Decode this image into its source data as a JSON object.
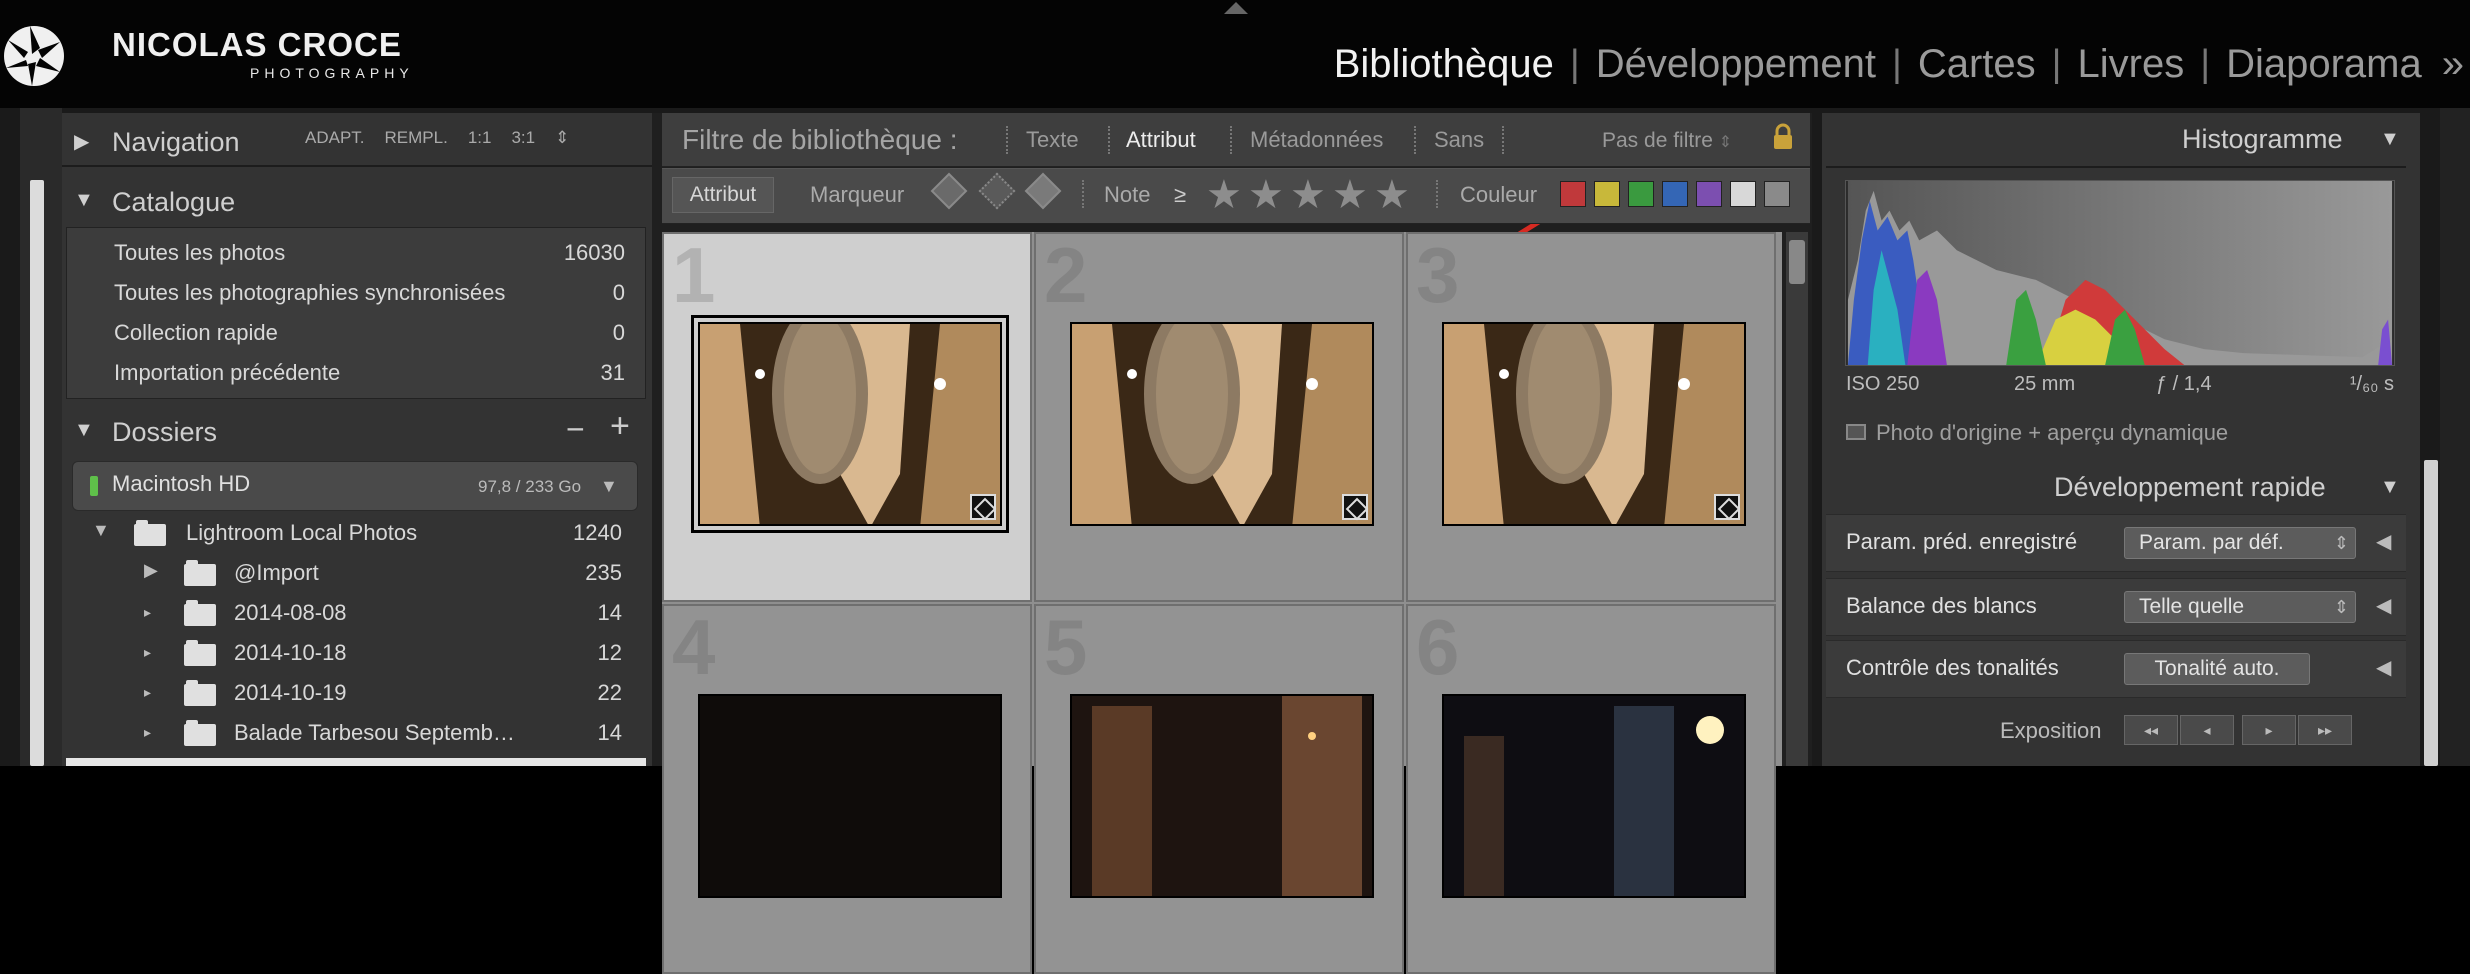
{
  "brand": {
    "name": "NICOLAS CROCE",
    "subtitle": "PHOTOGRAPHY"
  },
  "modules": [
    {
      "label": "Bibliothèque",
      "active": true
    },
    {
      "label": "Développement",
      "active": false
    },
    {
      "label": "Cartes",
      "active": false
    },
    {
      "label": "Livres",
      "active": false
    },
    {
      "label": "Diaporama",
      "active": false
    }
  ],
  "more_modules_icon": "»",
  "navigation": {
    "title": "Navigation",
    "options": [
      "ADAPT.",
      "REMPL.",
      "1:1",
      "3:1"
    ]
  },
  "catalogue": {
    "title": "Catalogue",
    "items": [
      {
        "label": "Toutes les photos",
        "count": "16030"
      },
      {
        "label": "Toutes les photographies synchronisées",
        "count": "0"
      },
      {
        "label": "Collection rapide",
        "count": "0"
      },
      {
        "label": "Importation précédente",
        "count": "31"
      }
    ]
  },
  "dossiers": {
    "title": "Dossiers",
    "minus": "−",
    "plus": "+",
    "volume": {
      "name": "Macintosh HD",
      "size": "97,8 / 233 Go"
    },
    "folders": [
      {
        "name": "Lightroom Local Photos",
        "count": "1240"
      },
      {
        "name": "@Import",
        "count": "235"
      },
      {
        "name": "2014-08-08",
        "count": "14"
      },
      {
        "name": "2014-10-18",
        "count": "12"
      },
      {
        "name": "2014-10-19",
        "count": "22"
      },
      {
        "name": "Balade Tarbesou Septemb…",
        "count": "14"
      }
    ]
  },
  "filter_bar": {
    "title": "Filtre de bibliothèque :",
    "options": [
      "Texte",
      "Attribut",
      "Métadonnées",
      "Sans"
    ],
    "active": "Attribut",
    "preset": "Pas de filtre",
    "preset_caret": "⇕"
  },
  "attribute_bar": {
    "attribut": "Attribut",
    "marqueur": "Marqueur",
    "note": "Note",
    "operator": "≥",
    "stars": [
      "★",
      "★",
      "★",
      "★",
      "★"
    ],
    "couleur": "Couleur",
    "colors": [
      "#c0393b",
      "#c8b83a",
      "#3a9a3f",
      "#3466b5",
      "#7c4fb0",
      "#d8d8d8",
      "#8a8a8a"
    ]
  },
  "grid": {
    "cells": [
      {
        "num": "1",
        "selected": true
      },
      {
        "num": "2",
        "selected": false
      },
      {
        "num": "3",
        "selected": false
      },
      {
        "num": "4",
        "selected": false
      },
      {
        "num": "5",
        "selected": false
      },
      {
        "num": "6",
        "selected": false
      }
    ]
  },
  "histogram": {
    "title": "Histogramme",
    "iso": "ISO 250",
    "focal": "25 mm",
    "aperture": "ƒ / 1,4",
    "shutter": "¹/₆₀ s",
    "preview": "Photo d'origine + aperçu dynamique"
  },
  "quick_develop": {
    "title": "Développement rapide",
    "rows": [
      {
        "label": "Param. préd. enregistré",
        "value": "Param. par déf."
      },
      {
        "label": "Balance des blancs",
        "value": "Telle quelle"
      },
      {
        "label": "Contrôle des tonalités",
        "button": "Tonalité auto."
      }
    ],
    "exposure": {
      "label": "Exposition",
      "buttons": [
        "◂◂",
        "◂",
        "▸",
        "▸▸"
      ]
    }
  },
  "icons": [
    "nc-aperture-logo-icon",
    "lock-icon",
    "triangle-disclosure-icon",
    "folder-icon",
    "flag-diamond-icon",
    "star-icon",
    "checkbox-icon"
  ]
}
